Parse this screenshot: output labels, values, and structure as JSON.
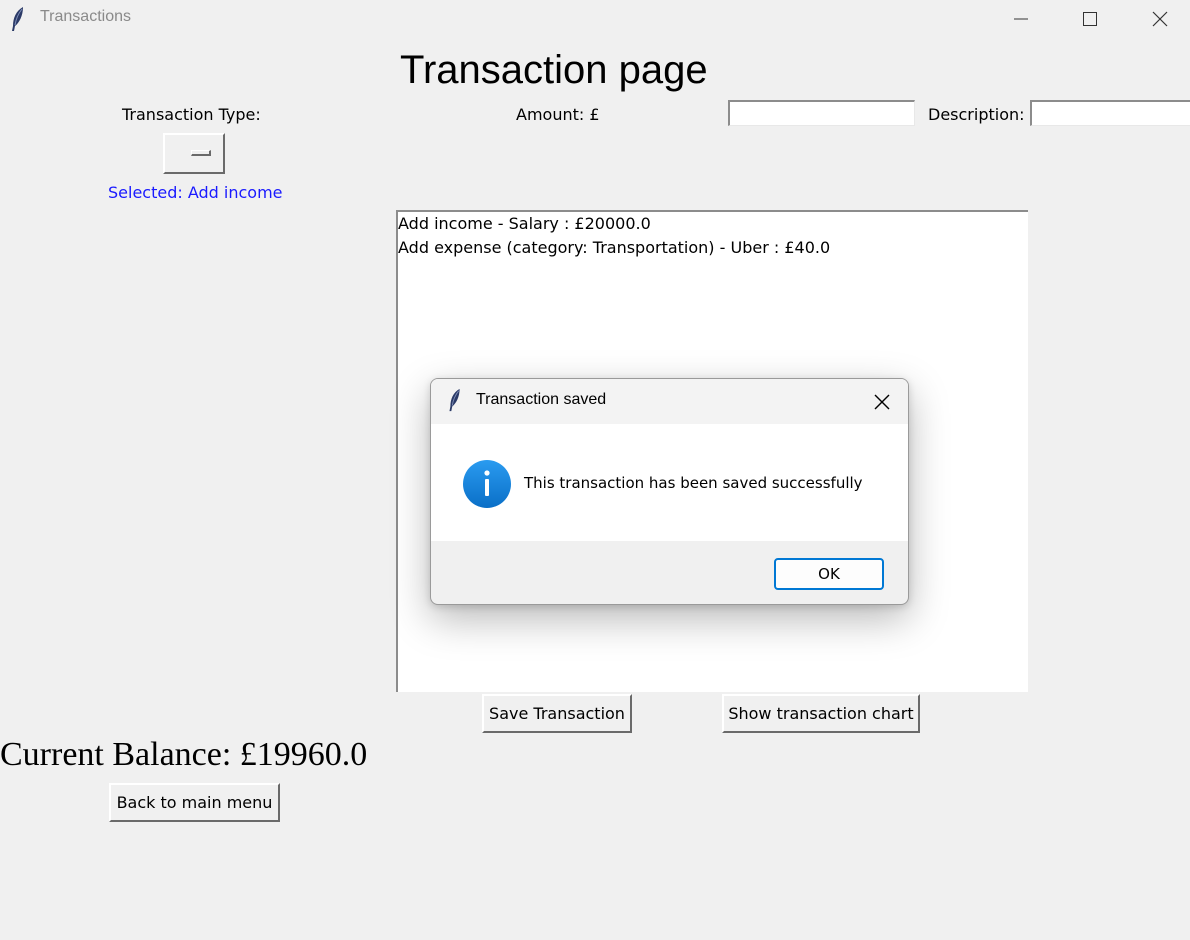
{
  "window": {
    "title": "Transactions"
  },
  "page": {
    "title": "Transaction page",
    "transaction_type_label": "Transaction Type:",
    "amount_label": "Amount: £",
    "amount_value": "",
    "description_label": "Description:",
    "description_value": "",
    "selected_text": "Selected: Add income",
    "selected_color": "#1a1aff"
  },
  "transactions": [
    "Add income - Salary : £20000.0",
    "Add expense (category: Transportation) - Uber : £40.0"
  ],
  "buttons": {
    "save": "Save Transaction",
    "chart": "Show transaction chart",
    "back": "Back to main menu"
  },
  "balance": "Current Balance: £19960.0",
  "dialog": {
    "title": "Transaction saved",
    "message": "This transaction has been saved successfully",
    "ok_label": "OK",
    "icon": "info-icon",
    "accent_color": "#0078d4"
  }
}
